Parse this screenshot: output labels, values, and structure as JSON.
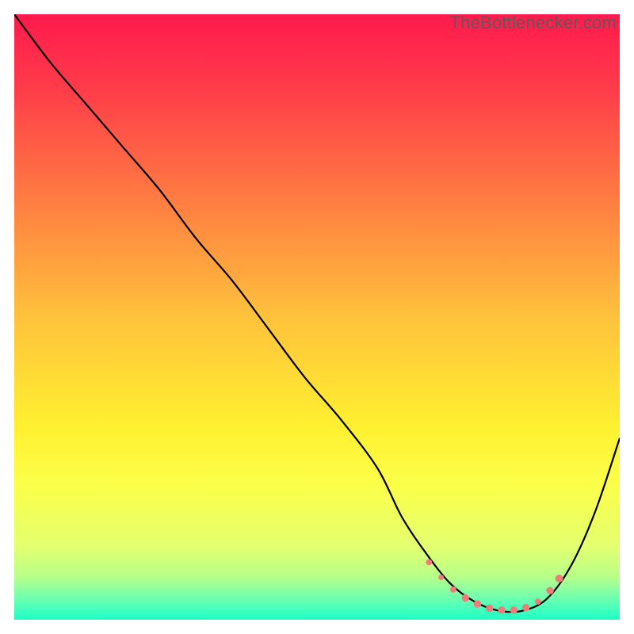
{
  "attribution": "TheBottlenecker.com",
  "chart_data": {
    "type": "line",
    "title": "",
    "xlabel": "",
    "ylabel": "",
    "xlim": [
      0,
      100
    ],
    "ylim": [
      0,
      100
    ],
    "background_gradient": [
      {
        "stop": 0.0,
        "color": "#ff1a4d"
      },
      {
        "stop": 0.12,
        "color": "#ff3b4a"
      },
      {
        "stop": 0.3,
        "color": "#ff7a42"
      },
      {
        "stop": 0.5,
        "color": "#ffc23c"
      },
      {
        "stop": 0.68,
        "color": "#fff030"
      },
      {
        "stop": 0.78,
        "color": "#fbff4a"
      },
      {
        "stop": 0.88,
        "color": "#e3ff70"
      },
      {
        "stop": 0.93,
        "color": "#b6ff8a"
      },
      {
        "stop": 0.965,
        "color": "#6dffb0"
      },
      {
        "stop": 1.0,
        "color": "#1cffc8"
      }
    ],
    "series": [
      {
        "name": "bottleneck-curve",
        "color": "#000000",
        "stroke_width": 2.2,
        "x": [
          0,
          6,
          12,
          18,
          24,
          30,
          36,
          42,
          48,
          54,
          60,
          64,
          68,
          72,
          76,
          80,
          84,
          88,
          92,
          96,
          100
        ],
        "y": [
          100,
          92,
          85,
          78,
          71,
          63,
          56,
          48,
          40,
          33,
          25,
          17,
          11,
          6,
          3,
          1.5,
          1.5,
          3.5,
          9,
          18,
          30
        ]
      }
    ],
    "highlight_points": {
      "name": "optimal-zone-markers",
      "color": "#ee7c78",
      "x": [
        68.5,
        70.5,
        72.5,
        74.5,
        76.5,
        78.5,
        80.5,
        82.5,
        84.5,
        86.5,
        88.5,
        90.0
      ],
      "y": [
        9.5,
        7.0,
        5.0,
        3.6,
        2.6,
        1.9,
        1.6,
        1.6,
        2.0,
        3.0,
        4.8,
        6.8
      ],
      "r": [
        3.4,
        3.0,
        3.4,
        4.1,
        4.1,
        4.1,
        4.1,
        4.1,
        4.1,
        3.4,
        4.1,
        4.3
      ]
    }
  }
}
